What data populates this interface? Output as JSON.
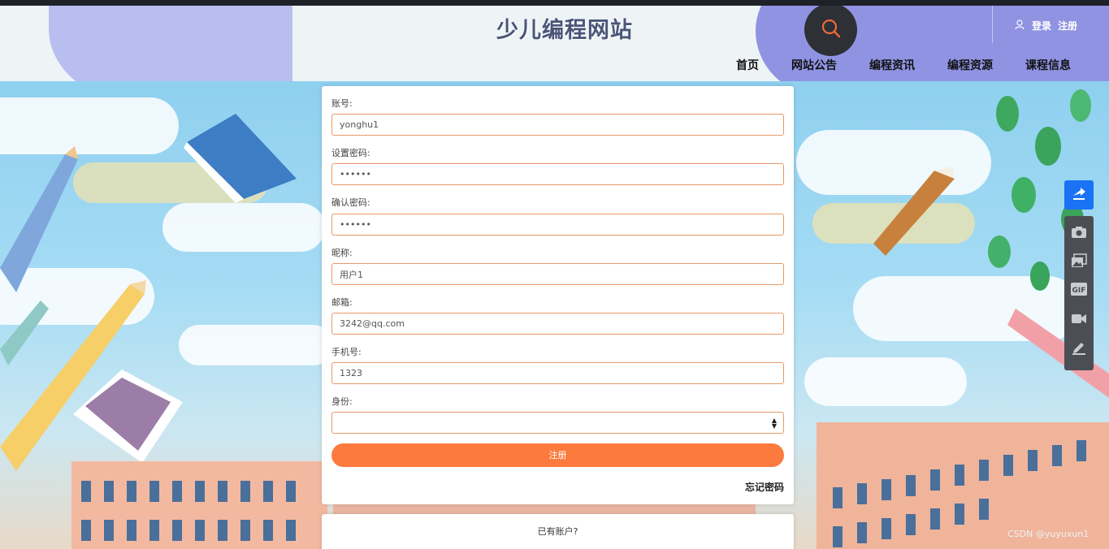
{
  "site": {
    "title": "少儿编程网站"
  },
  "header": {
    "login": "登录",
    "register": "注册",
    "nav": [
      "首页",
      "网站公告",
      "编程资讯",
      "编程资源",
      "课程信息"
    ]
  },
  "form": {
    "account_label": "账号:",
    "account_value": "yonghu1",
    "password_label": "设置密码:",
    "password_value": "••••••",
    "confirm_label": "确认密码:",
    "confirm_value": "••••••",
    "nickname_label": "昵称:",
    "nickname_value": "用户1",
    "email_label": "邮箱:",
    "email_value": "3242@qq.com",
    "phone_label": "手机号:",
    "phone_value": "1323",
    "identity_label": "身份:",
    "identity_value": "",
    "submit_label": "注册",
    "forgot_label": "忘记密码"
  },
  "footer_card": {
    "have_account": "已有账户?"
  },
  "watermark": "CSDN @yuyuxun1",
  "colors": {
    "accent": "#fc7a3d",
    "input_border": "#e59a68",
    "nav_blob": "#8f93e2"
  },
  "icons": [
    "search-icon",
    "user-icon",
    "share-icon",
    "camera-icon",
    "image-icon",
    "gif-icon",
    "video-icon",
    "pen-icon"
  ]
}
